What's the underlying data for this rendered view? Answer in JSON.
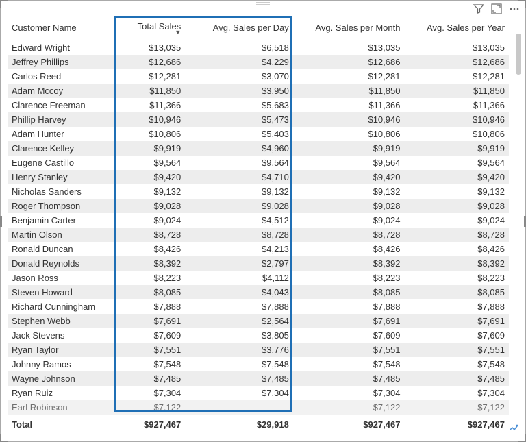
{
  "header": {
    "filter_icon": "filter",
    "focus_icon": "focus",
    "more_icon": "more-options"
  },
  "columns": {
    "customer": "Customer Name",
    "total_sales": "Total Sales",
    "avg_day": "Avg. Sales per Day",
    "avg_month": "Avg. Sales per Month",
    "avg_year": "Avg. Sales per Year"
  },
  "rows": [
    {
      "name": "Edward Wright",
      "total": "$13,035",
      "day": "$6,518",
      "month": "$13,035",
      "year": "$13,035"
    },
    {
      "name": "Jeffrey Phillips",
      "total": "$12,686",
      "day": "$4,229",
      "month": "$12,686",
      "year": "$12,686"
    },
    {
      "name": "Carlos Reed",
      "total": "$12,281",
      "day": "$3,070",
      "month": "$12,281",
      "year": "$12,281"
    },
    {
      "name": "Adam Mccoy",
      "total": "$11,850",
      "day": "$3,950",
      "month": "$11,850",
      "year": "$11,850"
    },
    {
      "name": "Clarence Freeman",
      "total": "$11,366",
      "day": "$5,683",
      "month": "$11,366",
      "year": "$11,366"
    },
    {
      "name": "Phillip Harvey",
      "total": "$10,946",
      "day": "$5,473",
      "month": "$10,946",
      "year": "$10,946"
    },
    {
      "name": "Adam Hunter",
      "total": "$10,806",
      "day": "$5,403",
      "month": "$10,806",
      "year": "$10,806"
    },
    {
      "name": "Clarence Kelley",
      "total": "$9,919",
      "day": "$4,960",
      "month": "$9,919",
      "year": "$9,919"
    },
    {
      "name": "Eugene Castillo",
      "total": "$9,564",
      "day": "$9,564",
      "month": "$9,564",
      "year": "$9,564"
    },
    {
      "name": "Henry Stanley",
      "total": "$9,420",
      "day": "$4,710",
      "month": "$9,420",
      "year": "$9,420"
    },
    {
      "name": "Nicholas Sanders",
      "total": "$9,132",
      "day": "$9,132",
      "month": "$9,132",
      "year": "$9,132"
    },
    {
      "name": "Roger Thompson",
      "total": "$9,028",
      "day": "$9,028",
      "month": "$9,028",
      "year": "$9,028"
    },
    {
      "name": "Benjamin Carter",
      "total": "$9,024",
      "day": "$4,512",
      "month": "$9,024",
      "year": "$9,024"
    },
    {
      "name": "Martin Olson",
      "total": "$8,728",
      "day": "$8,728",
      "month": "$8,728",
      "year": "$8,728"
    },
    {
      "name": "Ronald Duncan",
      "total": "$8,426",
      "day": "$4,213",
      "month": "$8,426",
      "year": "$8,426"
    },
    {
      "name": "Donald Reynolds",
      "total": "$8,392",
      "day": "$2,797",
      "month": "$8,392",
      "year": "$8,392"
    },
    {
      "name": "Jason Ross",
      "total": "$8,223",
      "day": "$4,112",
      "month": "$8,223",
      "year": "$8,223"
    },
    {
      "name": "Steven Howard",
      "total": "$8,085",
      "day": "$4,043",
      "month": "$8,085",
      "year": "$8,085"
    },
    {
      "name": "Richard Cunningham",
      "total": "$7,888",
      "day": "$7,888",
      "month": "$7,888",
      "year": "$7,888"
    },
    {
      "name": "Stephen Webb",
      "total": "$7,691",
      "day": "$2,564",
      "month": "$7,691",
      "year": "$7,691"
    },
    {
      "name": "Jack Stevens",
      "total": "$7,609",
      "day": "$3,805",
      "month": "$7,609",
      "year": "$7,609"
    },
    {
      "name": "Ryan Taylor",
      "total": "$7,551",
      "day": "$3,776",
      "month": "$7,551",
      "year": "$7,551"
    },
    {
      "name": "Johnny Ramos",
      "total": "$7,548",
      "day": "$7,548",
      "month": "$7,548",
      "year": "$7,548"
    },
    {
      "name": "Wayne Johnson",
      "total": "$7,485",
      "day": "$7,485",
      "month": "$7,485",
      "year": "$7,485"
    },
    {
      "name": "Ryan Ruiz",
      "total": "$7,304",
      "day": "$7,304",
      "month": "$7,304",
      "year": "$7,304"
    }
  ],
  "partial_row": {
    "name": "Earl Robinson",
    "total": "$7,122",
    "day": "",
    "month": "$7,122",
    "year": "$7,122"
  },
  "totals": {
    "label": "Total",
    "total": "$927,467",
    "day": "$29,918",
    "month": "$927,467",
    "year": "$927,467"
  },
  "chart_data": {
    "type": "table",
    "title": "Customer Sales",
    "columns": [
      "Customer Name",
      "Total Sales",
      "Avg. Sales per Day",
      "Avg. Sales per Month",
      "Avg. Sales per Year"
    ],
    "sort": {
      "column": "Total Sales",
      "direction": "desc"
    },
    "rows": [
      [
        "Edward Wright",
        13035,
        6518,
        13035,
        13035
      ],
      [
        "Jeffrey Phillips",
        12686,
        4229,
        12686,
        12686
      ],
      [
        "Carlos Reed",
        12281,
        3070,
        12281,
        12281
      ],
      [
        "Adam Mccoy",
        11850,
        3950,
        11850,
        11850
      ],
      [
        "Clarence Freeman",
        11366,
        5683,
        11366,
        11366
      ],
      [
        "Phillip Harvey",
        10946,
        5473,
        10946,
        10946
      ],
      [
        "Adam Hunter",
        10806,
        5403,
        10806,
        10806
      ],
      [
        "Clarence Kelley",
        9919,
        4960,
        9919,
        9919
      ],
      [
        "Eugene Castillo",
        9564,
        9564,
        9564,
        9564
      ],
      [
        "Henry Stanley",
        9420,
        4710,
        9420,
        9420
      ],
      [
        "Nicholas Sanders",
        9132,
        9132,
        9132,
        9132
      ],
      [
        "Roger Thompson",
        9028,
        9028,
        9028,
        9028
      ],
      [
        "Benjamin Carter",
        9024,
        4512,
        9024,
        9024
      ],
      [
        "Martin Olson",
        8728,
        8728,
        8728,
        8728
      ],
      [
        "Ronald Duncan",
        8426,
        4213,
        8426,
        8426
      ],
      [
        "Donald Reynolds",
        8392,
        2797,
        8392,
        8392
      ],
      [
        "Jason Ross",
        8223,
        4112,
        8223,
        8223
      ],
      [
        "Steven Howard",
        8085,
        4043,
        8085,
        8085
      ],
      [
        "Richard Cunningham",
        7888,
        7888,
        7888,
        7888
      ],
      [
        "Stephen Webb",
        7691,
        2564,
        7691,
        7691
      ],
      [
        "Jack Stevens",
        7609,
        3805,
        7609,
        7609
      ],
      [
        "Ryan Taylor",
        7551,
        3776,
        7551,
        7551
      ],
      [
        "Johnny Ramos",
        7548,
        7548,
        7548,
        7548
      ],
      [
        "Wayne Johnson",
        7485,
        7485,
        7485,
        7485
      ],
      [
        "Ryan Ruiz",
        7304,
        7304,
        7304,
        7304
      ]
    ],
    "totals": [
      "Total",
      927467,
      29918,
      927467,
      927467
    ]
  }
}
